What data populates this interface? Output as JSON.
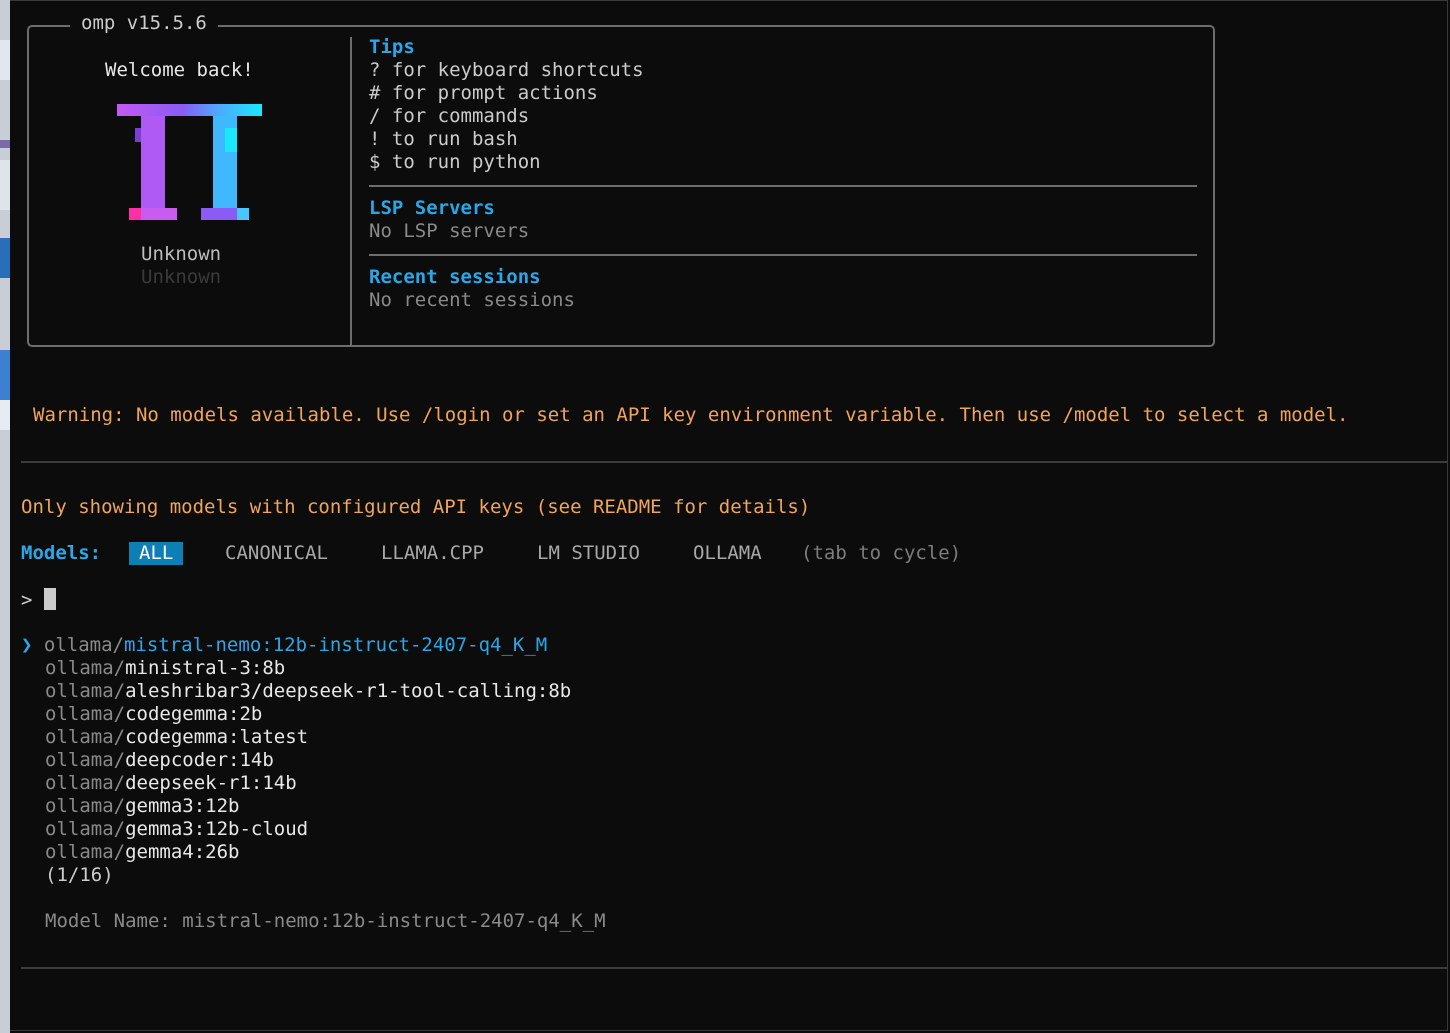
{
  "app": {
    "title": "omp v15.5.6"
  },
  "welcome": {
    "greeting": "Welcome back!",
    "user_line1": "Unknown",
    "user_line2": "Unknown"
  },
  "tips": {
    "heading": "Tips",
    "items": [
      "? for keyboard shortcuts",
      "# for prompt actions",
      "/ for commands",
      "! to run bash",
      "$ to run python"
    ]
  },
  "lsp": {
    "heading": "LSP Servers",
    "status": "No LSP servers"
  },
  "recent": {
    "heading": "Recent sessions",
    "status": "No recent sessions"
  },
  "warning": "Warning: No models available. Use /login or set an API key environment variable. Then use /model to select a model.",
  "notice": "Only showing models with configured API keys (see README for details)",
  "models_bar": {
    "label": "Models:",
    "tabs": [
      "ALL",
      "CANONICAL",
      "LLAMA.CPP",
      "LM STUDIO",
      "OLLAMA"
    ],
    "active": "ALL",
    "hint": "(tab to cycle)"
  },
  "prompt": {
    "symbol": ">",
    "value": ""
  },
  "model_list": {
    "pointer": "❯",
    "provider": "ollama/",
    "items": [
      "mistral-nemo:12b-instruct-2407-q4_K_M",
      "ministral-3:8b",
      "aleshribar3/deepseek-r1-tool-calling:8b",
      "codegemma:2b",
      "codegemma:latest",
      "deepcoder:14b",
      "deepseek-r1:14b",
      "gemma3:12b",
      "gemma3:12b-cloud",
      "gemma4:26b"
    ],
    "counter": "(1/16)"
  },
  "detail": {
    "label": "Model Name:",
    "value": "mistral-nemo:12b-instruct-2407-q4_K_M"
  },
  "colors": {
    "background": "#0c0c0c",
    "accent": "#2aa7e8",
    "warning": "#f0a55a",
    "active_tab": "#0e7fb5",
    "border": "#6d6d6d"
  }
}
